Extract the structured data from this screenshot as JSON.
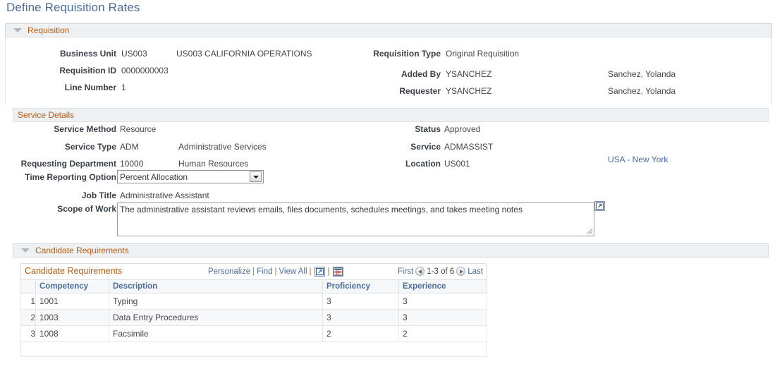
{
  "page": {
    "title": "Define Requisition Rates"
  },
  "requisition": {
    "caption": "Requisition",
    "left_fields": [
      {
        "label": "Business Unit",
        "value": "US003",
        "desc": "US003 CALIFORNIA OPERATIONS"
      },
      {
        "label": "Requisition ID",
        "value": "0000000003",
        "desc": ""
      },
      {
        "label": "Line Number",
        "value": "1",
        "desc": ""
      }
    ],
    "right_fields": [
      {
        "label": "Requisition Type",
        "value": "Original Requisition",
        "desc": ""
      },
      {
        "label": "Added By",
        "value": "YSANCHEZ",
        "desc": "Sanchez, Yolanda"
      },
      {
        "label": "Requester",
        "value": "YSANCHEZ",
        "desc": "Sanchez, Yolanda"
      }
    ]
  },
  "service_details": {
    "caption": "Service Details",
    "left_fields": [
      {
        "label": "Service Method",
        "value": "Resource",
        "desc": ""
      },
      {
        "label": "Service Type",
        "value": "ADM",
        "desc": "Administrative Services"
      },
      {
        "label": "Requesting Department",
        "value": "10000",
        "desc": "Human Resources"
      }
    ],
    "right_fields": [
      {
        "label": "Status",
        "value": "Approved",
        "desc": ""
      },
      {
        "label": "Service",
        "value": "ADMASSIST",
        "desc": ""
      },
      {
        "label": "Location",
        "value": "US001",
        "desc": "USA - New York"
      }
    ],
    "time_reporting_option": {
      "label": "Time Reporting Option",
      "value": "Percent Allocation"
    },
    "job_title": {
      "label": "Job Title",
      "value": "Administrative Assistant"
    },
    "scope_of_work": {
      "label": "Scope of Work",
      "value": "The administrative assistant reviews emails, files documents, schedules meetings, and takes meeting notes"
    }
  },
  "candidate_requirements": {
    "caption": "Candidate Requirements",
    "grid_title": "Candidate Requirements",
    "actions": {
      "personalize": "Personalize",
      "find": "Find",
      "view_all": "View All",
      "separator": "|",
      "expand_icon": "expand-grid-icon",
      "download_icon": "download-spreadsheet-icon"
    },
    "nav": {
      "first": "First",
      "range": "1-3 of 6",
      "last": "Last",
      "prev_icon": "previous-page-icon",
      "next_icon": "next-page-icon"
    },
    "columns": [
      "",
      "Competency",
      "Description",
      "Proficiency",
      "Experience"
    ],
    "rows": [
      {
        "num": "1",
        "competency": "1001",
        "description": "Typing",
        "proficiency": "3",
        "experience": "3"
      },
      {
        "num": "2",
        "competency": "1003",
        "description": "Data Entry Procedures",
        "proficiency": "3",
        "experience": "3"
      },
      {
        "num": "3",
        "competency": "1008",
        "description": "Facsimile",
        "proficiency": "2",
        "experience": "2"
      }
    ]
  },
  "colors": {
    "title": "#4a6d9e",
    "caption": "#ba5c12",
    "link": "#4a6d9e",
    "bar_bg": "#eef1f3"
  }
}
